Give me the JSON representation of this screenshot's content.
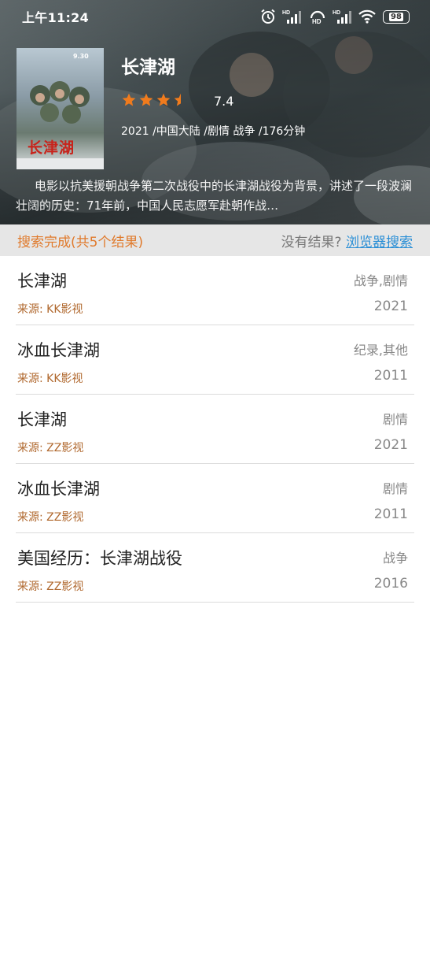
{
  "status_bar": {
    "time": "上午11:24",
    "battery": "98",
    "hd1": "HD",
    "hd2": "HD"
  },
  "movie": {
    "title": "长津湖",
    "rating": "7.4",
    "rating_stars": 3.5,
    "meta": "2021 /中国大陆 /剧情 战争 /176分钟",
    "synopsis": "电影以抗美援朝战争第二次战役中的长津湖战役为背景，讲述了一段波澜壮阔的历史：71年前，中国人民志愿军赴朝作战…",
    "poster_text": "长津湖",
    "poster_date": "9.30"
  },
  "search_status": {
    "done_text": "搜索完成(共5个结果)",
    "no_result_text": "没有结果? ",
    "browser_search_link": "浏览器搜索"
  },
  "colors": {
    "accent_orange": "#e07a2c",
    "link_blue": "#2b8fd6",
    "star_orange": "#f07b1d"
  },
  "results": [
    {
      "title": "长津湖",
      "genre": "战争,剧情",
      "source": "来源: KK影视",
      "year": "2021"
    },
    {
      "title": "冰血长津湖",
      "genre": "纪录,其他",
      "source": "来源: KK影视",
      "year": "2011"
    },
    {
      "title": "长津湖",
      "genre": "剧情",
      "source": "来源: ZZ影视",
      "year": "2021"
    },
    {
      "title": "冰血长津湖",
      "genre": "剧情",
      "source": "来源: ZZ影视",
      "year": "2011"
    },
    {
      "title": "美国经历：长津湖战役",
      "genre": "战争",
      "source": "来源: ZZ影视",
      "year": "2016"
    }
  ]
}
